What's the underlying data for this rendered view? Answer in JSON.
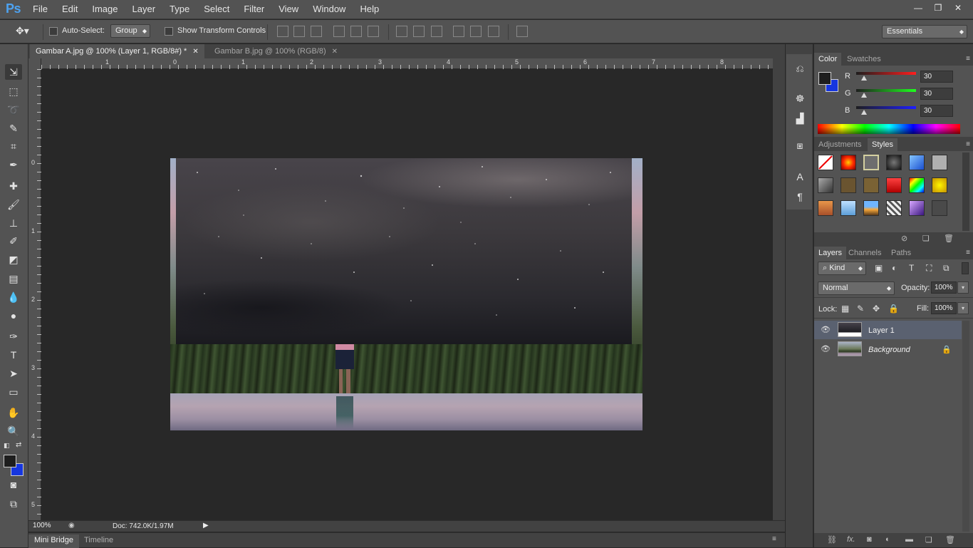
{
  "app": {
    "logo": "Ps"
  },
  "menu": [
    "File",
    "Edit",
    "Image",
    "Layer",
    "Type",
    "Select",
    "Filter",
    "View",
    "Window",
    "Help"
  ],
  "window_controls": {
    "minimize": "—",
    "restore": "❐",
    "close": "✕"
  },
  "options": {
    "auto_select_label": "Auto-Select:",
    "auto_select_value": "Group",
    "transform_label": "Show Transform Controls",
    "workspace": "Essentials"
  },
  "tabs": [
    {
      "label": "Gambar A.jpg @ 100% (Layer 1, RGB/8#) *",
      "active": true
    },
    {
      "label": "Gambar B.jpg @ 100% (RGB/8)",
      "active": false
    }
  ],
  "ruler_top": [
    "1",
    "0",
    "1",
    "2",
    "3",
    "4",
    "5",
    "6",
    "7",
    "8"
  ],
  "ruler_left": [
    "0",
    "1",
    "2",
    "3",
    "4",
    "5"
  ],
  "status": {
    "zoom": "100%",
    "doc": "Doc: 742.0K/1.97M"
  },
  "bottom_tabs": [
    "Mini Bridge",
    "Timeline"
  ],
  "color_panel": {
    "tabs": [
      "Color",
      "Swatches"
    ],
    "r_label": "R",
    "g_label": "G",
    "b_label": "B",
    "r": "30",
    "g": "30",
    "b": "30",
    "foreground": "#1e1e1e",
    "background": "#1636e0"
  },
  "styles_panel": {
    "tabs": [
      "Adjustments",
      "Styles"
    ]
  },
  "layers_panel": {
    "tabs": [
      "Layers",
      "Channels",
      "Paths"
    ],
    "kind": "Kind",
    "blend_mode": "Normal",
    "opacity_label": "Opacity:",
    "opacity": "100%",
    "lock_label": "Lock:",
    "fill_label": "Fill:",
    "fill": "100%",
    "layers": [
      {
        "name": "Layer 1",
        "selected": true
      },
      {
        "name": "Background",
        "selected": false,
        "locked": true
      }
    ]
  }
}
